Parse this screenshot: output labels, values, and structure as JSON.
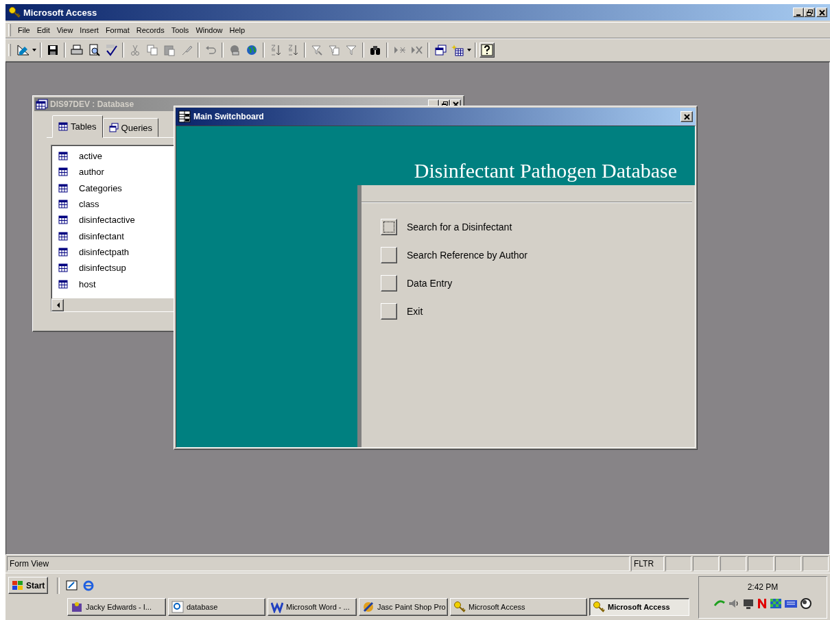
{
  "app": {
    "title": "Microsoft Access"
  },
  "menu": [
    {
      "label": "File"
    },
    {
      "label": "Edit"
    },
    {
      "label": "View"
    },
    {
      "label": "Insert"
    },
    {
      "label": "Format"
    },
    {
      "label": "Records"
    },
    {
      "label": "Tools"
    },
    {
      "label": "Window"
    },
    {
      "label": "Help"
    }
  ],
  "database_window": {
    "title": "DIS97DEV : Database",
    "tabs": [
      {
        "label": "Tables",
        "selected": true
      },
      {
        "label": "Queries",
        "selected": false
      }
    ],
    "tables": [
      "active",
      "author",
      "Categories",
      "class",
      "disinfectactive",
      "disinfectant",
      "disinfectpath",
      "disinfectsup",
      "host"
    ]
  },
  "switchboard": {
    "title": "Main Switchboard",
    "heading": "Disinfectant Pathogen Database",
    "items": [
      {
        "label": "Search for a Disinfectant",
        "focused": true
      },
      {
        "label": "Search Reference by Author",
        "focused": false
      },
      {
        "label": "Data Entry",
        "focused": false
      },
      {
        "label": "Exit",
        "focused": false
      }
    ]
  },
  "status_bar": {
    "text": "Form View",
    "indicator": "FLTR"
  },
  "taskbar": {
    "start": "Start",
    "clock": "2:42 PM",
    "tasks": [
      {
        "label": "Jacky Edwards - I...",
        "selected": false
      },
      {
        "label": "database",
        "selected": false
      },
      {
        "label": "Microsoft Word - ...",
        "selected": false
      },
      {
        "label": "Jasc Paint Shop Pro",
        "selected": false
      },
      {
        "label": "Microsoft Access",
        "selected": false
      },
      {
        "label": "Microsoft Access",
        "selected": true
      }
    ]
  }
}
